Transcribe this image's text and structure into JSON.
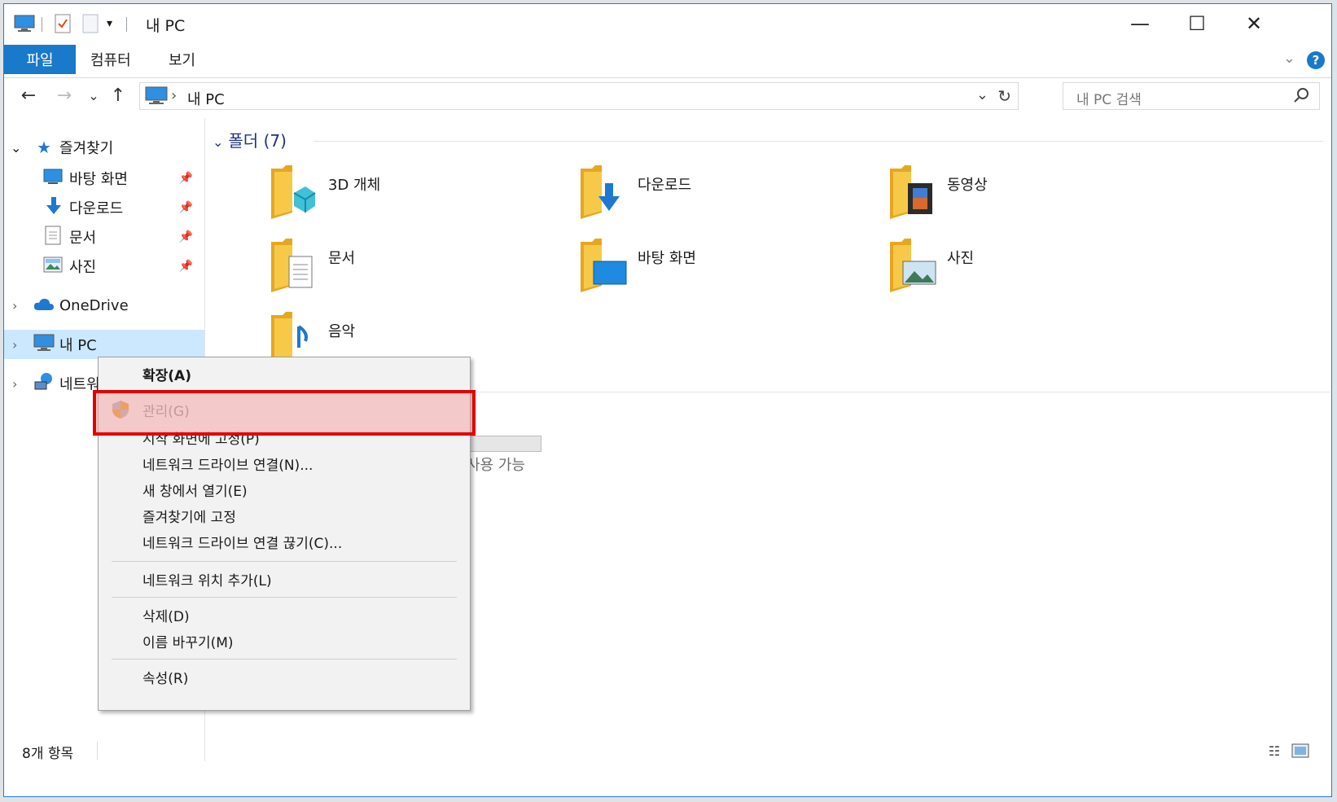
{
  "window": {
    "title": "내 PC",
    "controls": {
      "minimize": "—",
      "maximize": "☐",
      "close": "✕"
    }
  },
  "quick_access_toolbar": [
    "pc-icon",
    "properties-icon",
    "new-folder-icon",
    "customize-arrow"
  ],
  "ribbon": {
    "tabs": [
      "파일",
      "컴퓨터",
      "보기"
    ],
    "help": "?"
  },
  "navigation": {
    "back": "←",
    "forward": "→",
    "recent": "⌄",
    "up": "↑",
    "address": {
      "separator": "›",
      "location": "내 PC",
      "refresh": "↻",
      "dropdown": "⌄"
    },
    "search": {
      "placeholder": "내 PC 검색"
    }
  },
  "nav_pane": {
    "quick_access": {
      "label": "즐겨찾기",
      "items": [
        {
          "label": "바탕 화면",
          "icon": "desktop-icon"
        },
        {
          "label": "다운로드",
          "icon": "download-icon"
        },
        {
          "label": "문서",
          "icon": "document-icon"
        },
        {
          "label": "사진",
          "icon": "picture-icon"
        }
      ]
    },
    "onedrive": "OneDrive",
    "this_pc": "내 PC",
    "network": "네트워크"
  },
  "content": {
    "folders_header": "폴더 (7)",
    "folders": [
      {
        "label": "3D 개체",
        "icon": "3d-objects-icon"
      },
      {
        "label": "다운로드",
        "icon": "downloads-folder-icon"
      },
      {
        "label": "동영상",
        "icon": "videos-folder-icon"
      },
      {
        "label": "문서",
        "icon": "documents-folder-icon"
      },
      {
        "label": "바탕 화면",
        "icon": "desktop-folder-icon"
      },
      {
        "label": "사진",
        "icon": "pictures-folder-icon"
      },
      {
        "label": "음악",
        "icon": "music-folder-icon"
      }
    ],
    "drive_partial_text": "사용 가능"
  },
  "status_bar": {
    "item_count": "8개 항목",
    "views": [
      "details-view-icon",
      "large-icons-view-icon"
    ]
  },
  "context_menu": {
    "items": [
      {
        "label": "확장(A)",
        "bold": true
      },
      {
        "label": "관리(G)",
        "disabled": true,
        "icon": "shield-icon",
        "highlighted": true
      },
      {
        "label": "시작 화면에 고정(P)"
      },
      {
        "label": "네트워크 드라이브 연결(N)..."
      },
      {
        "label": "새 창에서 열기(E)"
      },
      {
        "label": "즐겨찾기에 고정"
      },
      {
        "label": "네트워크 드라이브 연결 끊기(C)..."
      },
      {
        "label": "네트워크 위치 추가(L)"
      },
      {
        "label": "삭제(D)"
      },
      {
        "label": "이름 바꾸기(M)"
      },
      {
        "label": "속성(R)"
      }
    ]
  },
  "colors": {
    "accent": "#1979ca",
    "selection": "#cce8ff",
    "highlight_border": "#e30000",
    "folder": "#f7c948"
  }
}
